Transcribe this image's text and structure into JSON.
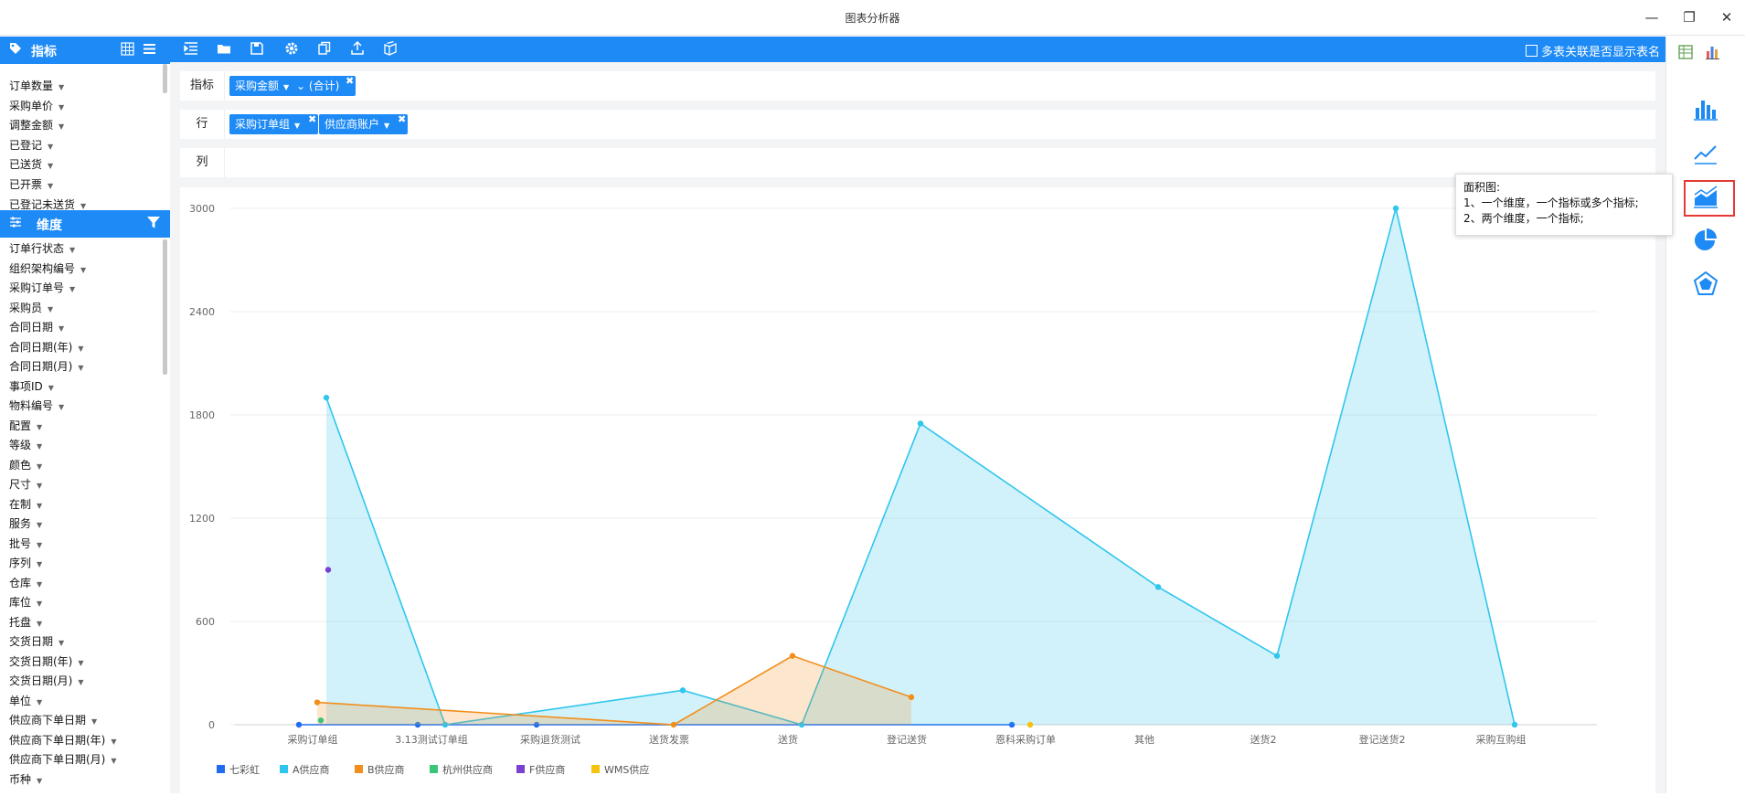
{
  "window": {
    "title": "图表分析器",
    "minimize": "—",
    "restore": "❐",
    "close": "✕"
  },
  "left": {
    "metrics_title": "指标",
    "metrics": [
      "订单数量",
      "采购单价",
      "调整金额",
      "已登记",
      "已送货",
      "已开票",
      "已登记未送货"
    ],
    "dims_title": "维度",
    "dims": [
      "订单行状态",
      "组织架构编号",
      "采购订单号",
      "采购员",
      "合同日期",
      "合同日期(年)",
      "合同日期(月)",
      "事项ID",
      "物料编号",
      "配置",
      "等级",
      "颜色",
      "尺寸",
      "在制",
      "服务",
      "批号",
      "序列",
      "仓库",
      "库位",
      "托盘",
      "交货日期",
      "交货日期(年)",
      "交货日期(月)",
      "单位",
      "供应商下单日期",
      "供应商下单日期(年)",
      "供应商下单日期(月)",
      "币种"
    ]
  },
  "toolbar": {
    "option_label": "多表关联是否显示表名"
  },
  "rows": {
    "metric_label": "指标",
    "metric_pill": "采购金额",
    "metric_agg": "(合计)",
    "row_label": "行",
    "row_pills": [
      "采购订单组",
      "供应商账户"
    ],
    "col_label": "列"
  },
  "tooltip": {
    "title": "面积图:",
    "line1": "1、一个维度，一个指标或多个指标;",
    "line2": "2、两个维度，一个指标;"
  },
  "colors": {
    "accent": "#1d8af5",
    "highlight": "#e53935"
  },
  "chart_data": {
    "type": "area",
    "categories": [
      "采购订单组",
      "3.13测试订单组",
      "采购退货测试",
      "送货发票",
      "送货",
      "登记送货",
      "恩科采购订单",
      "其他",
      "送货2",
      "登记送货2",
      "采购互购组"
    ],
    "yticks": [
      0,
      600,
      1200,
      1800,
      2400,
      3000
    ],
    "ylim": [
      0,
      3000
    ],
    "grid": true,
    "legend_position": "bottom-left",
    "series": [
      {
        "name": "七彩虹",
        "color": "#1f6bf2",
        "points": [
          {
            "x": "采购订单组",
            "y": 0
          },
          {
            "x": "3.13测试订单组",
            "y": 0
          },
          {
            "x": "采购退货测试",
            "y": 0
          },
          {
            "x": "恩科采购订单",
            "y": 0
          }
        ]
      },
      {
        "name": "A供应商",
        "color": "#2fc6ee",
        "points": [
          {
            "x": "采购订单组",
            "y": 1900
          },
          {
            "x": "3.13测试订单组",
            "y": 0
          },
          {
            "x": "送货发票",
            "y": 200
          },
          {
            "x": "送货",
            "y": 0
          },
          {
            "x": "登记送货",
            "y": 1750
          },
          {
            "x": "其他",
            "y": 800
          },
          {
            "x": "送货2",
            "y": 400
          },
          {
            "x": "登记送货2",
            "y": 3000
          },
          {
            "x": "采购互购组",
            "y": 0
          }
        ]
      },
      {
        "name": "B供应商",
        "color": "#f28e1c",
        "points": [
          {
            "x": "采购订单组",
            "y": 130
          },
          {
            "x": "送货发票",
            "y": 0
          },
          {
            "x": "送货",
            "y": 400
          },
          {
            "x": "登记送货",
            "y": 160
          }
        ]
      },
      {
        "name": "杭州供应商",
        "color": "#3cc47a",
        "points": [
          {
            "x": "采购订单组",
            "y": 25
          }
        ]
      },
      {
        "name": "F供应商",
        "color": "#7b3fd1",
        "points": [
          {
            "x": "采购订单组",
            "y": 900
          }
        ]
      },
      {
        "name": "WMS供应",
        "color": "#f5c20c",
        "points": [
          {
            "x": "恩科采购订单",
            "y": 0
          }
        ]
      }
    ]
  }
}
